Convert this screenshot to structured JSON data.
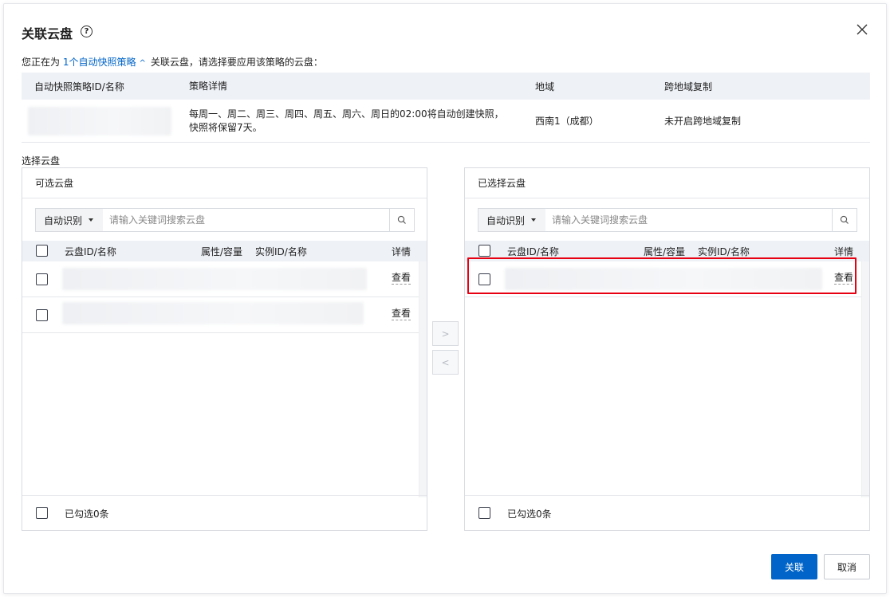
{
  "dialog": {
    "title": "关联云盘",
    "help_icon": "question-circle-icon",
    "close_icon": "close-icon"
  },
  "intro": {
    "prefix": "您正在为",
    "policy_link": "1个自动快照策略",
    "suffix": "关联云盘，请选择要应用该策略的云盘："
  },
  "policy_table": {
    "headers": [
      "自动快照策略ID/名称",
      "策略详情",
      "地域",
      "跨地域复制"
    ],
    "row": {
      "detail_line1": "每周一、周二、周三、周四、周五、周六、周日的02:00将自动创建快照，",
      "detail_line2": "快照将保留7天。",
      "region": "西南1（成都）",
      "cross_region": "未开启跨地域复制"
    }
  },
  "section_label": "选择云盘",
  "available_panel": {
    "title": "可选云盘",
    "search_mode": "自动识别",
    "search_placeholder": "请输入关键词搜索云盘",
    "headers": [
      "云盘ID/名称",
      "属性/容量",
      "实例ID/名称",
      "详情"
    ],
    "rows": [
      {
        "view": "查看"
      },
      {
        "view": "查看"
      }
    ],
    "footer": "已勾选0条"
  },
  "selected_panel": {
    "title": "已选择云盘",
    "search_mode": "自动识别",
    "search_placeholder": "请输入关键词搜索云盘",
    "headers": [
      "云盘ID/名称",
      "属性/容量",
      "实例ID/名称",
      "详情"
    ],
    "rows": [
      {
        "view": "查看"
      }
    ],
    "footer": "已勾选0条"
  },
  "transfer": {
    "right_icon": "chevron-right-icon",
    "left_icon": "chevron-left-icon"
  },
  "actions": {
    "confirm": "关联",
    "cancel": "取消"
  },
  "colors": {
    "primary": "#0064c8",
    "highlight": "#e60012",
    "header_bg": "#eef1f6"
  }
}
